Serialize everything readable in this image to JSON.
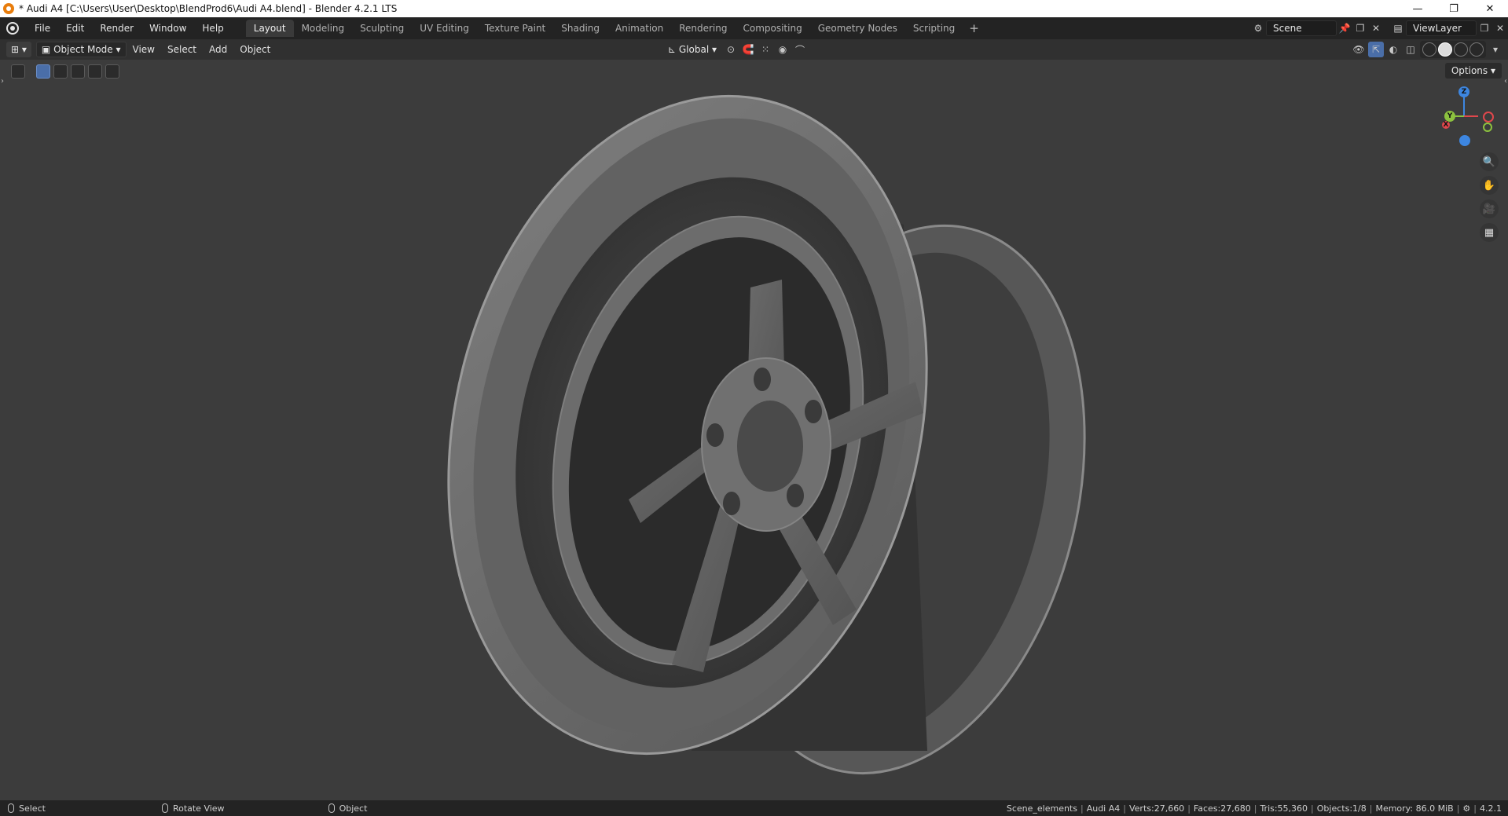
{
  "window": {
    "title": "* Audi A4 [C:\\Users\\User\\Desktop\\BlendProd6\\Audi A4.blend] - Blender 4.2.1 LTS",
    "controls": [
      "—",
      "❐",
      "✕"
    ]
  },
  "menubar": {
    "items": [
      "File",
      "Edit",
      "Render",
      "Window",
      "Help"
    ]
  },
  "workspaces": {
    "tabs": [
      "Layout",
      "Modeling",
      "Sculpting",
      "UV Editing",
      "Texture Paint",
      "Shading",
      "Animation",
      "Rendering",
      "Compositing",
      "Geometry Nodes",
      "Scripting"
    ],
    "active": "Layout",
    "add": "+"
  },
  "scene": {
    "name": "Scene",
    "view_layer": "ViewLayer"
  },
  "viewport_header": {
    "mode": "Object Mode",
    "menus": [
      "View",
      "Select",
      "Add",
      "Object"
    ],
    "orientation": "Global"
  },
  "viewport": {
    "options_label": "Options",
    "gizmo": {
      "x": "X",
      "y": "Y",
      "z": "Z"
    },
    "colors": {
      "x_axis": "#e0474c",
      "y_axis": "#8cc13f",
      "z_axis": "#3d86e0",
      "bg": "#3c3c3c",
      "rim": "#7a7a7a"
    }
  },
  "statusbar": {
    "select": "Select",
    "rotate": "Rotate View",
    "object": "Object",
    "collection": "Scene_elements",
    "object_name": "Audi A4",
    "verts": "Verts:27,660",
    "faces": "Faces:27,680",
    "tris": "Tris:55,360",
    "objects": "Objects:1/8",
    "memory": "Memory: 86.0 MiB",
    "version": "4.2.1"
  }
}
